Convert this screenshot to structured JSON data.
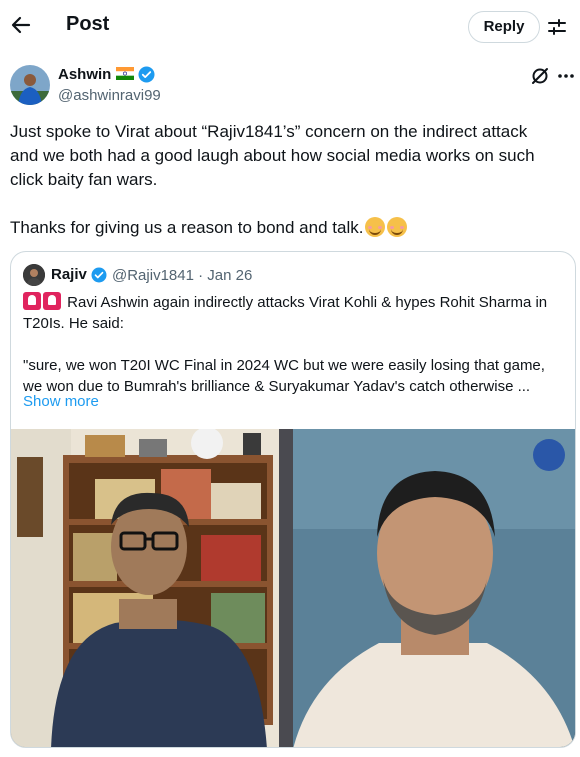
{
  "header": {
    "title": "Post",
    "reply_label": "Reply",
    "back_icon": "arrow-left-icon",
    "filter_icon": "sliders-icon"
  },
  "post": {
    "author_name": "Ashwin",
    "author_handle": "@ashwinravi99",
    "verified": true,
    "text_lines": [
      "Just spoke to Virat about “Rajiv1841’s” concern on the indirect attack",
      "and we both had a good laugh about how social media works on such",
      "click baity fan wars."
    ],
    "text_line2": "Thanks for giving us a reason to bond and talk."
  },
  "quoted": {
    "author_name": "Rajiv",
    "handle_date": "@Rajiv1841 · Jan 26",
    "lines": [
      "Ravi Ashwin again indirectly attacks Virat Kohli & hypes Rohit Sharma in",
      "T20Is. He said:",
      "\"sure, we won T20I WC Final in 2024 WC but we were easily losing that game,",
      "we won due to Bumrah's brilliance & Suryakumar Yadav's catch otherwise ..."
    ],
    "show_more": "Show more"
  },
  "colors": {
    "accent": "#1d9bf0",
    "text": "#0f1419",
    "muted": "#536471",
    "border": "#cfd9de"
  }
}
